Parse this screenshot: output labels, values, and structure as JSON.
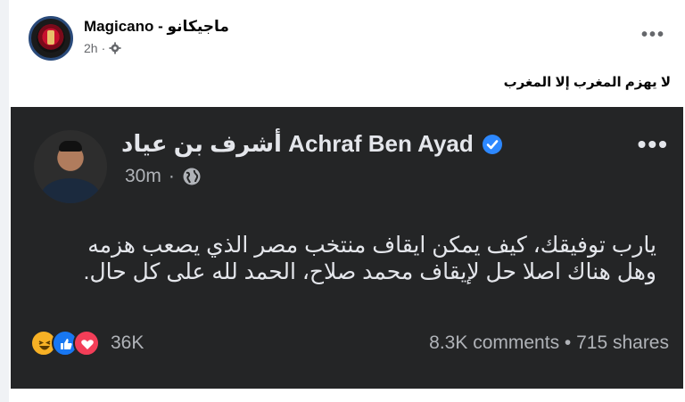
{
  "post": {
    "page_name": "Magicano - ماجيكانو",
    "time": "2h",
    "caption": "لا يهزم المغرب إلا المغرب"
  },
  "shared": {
    "author": "أشرف بن عياد Achraf Ben Ayad",
    "time": "30m",
    "text_line1": "يارب توفيقك، كيف يمكن ايقاف منتخب مصر الذي يصعب هزمه",
    "text_line2": "وهل هناك اصلا حل لإيقاف  محمد صلاح، الحمد لله على كل حال.",
    "reaction_count": "36K",
    "comments_shares": "8.3K comments • 715 shares"
  },
  "icons": [
    "gear-icon",
    "verified-icon",
    "globe-icon",
    "haha-icon",
    "like-icon",
    "love-icon",
    "more-icon"
  ],
  "colors": {
    "dark_bg": "#242526",
    "verified": "#2d88ff",
    "like": "#1877f2",
    "love": "#f33e58",
    "haha": "#f7b125"
  }
}
